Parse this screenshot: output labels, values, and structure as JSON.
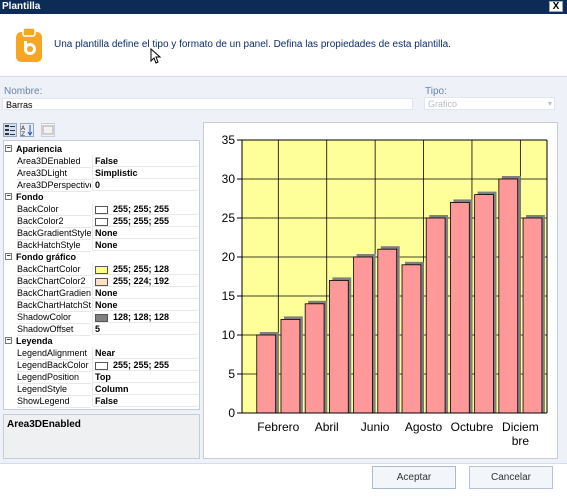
{
  "window": {
    "title": "Plantilla",
    "close_label": "X"
  },
  "header": {
    "intro": "Una plantilla define el tipo y formato de un panel. Defina las propiedades de esta plantilla.",
    "logo_icon": "template-document-icon"
  },
  "form": {
    "name_label": "Nombre:",
    "name_value": "Barras",
    "type_label": "Tipo:",
    "type_value": "Grafico"
  },
  "property_grid": {
    "categories": [
      {
        "name": "Apariencia",
        "items": [
          {
            "name": "Area3DEnabled",
            "value": "False"
          },
          {
            "name": "Area3DLight",
            "value": "Simplistic"
          },
          {
            "name": "Area3DPerspective",
            "value": "0"
          }
        ]
      },
      {
        "name": "Fondo",
        "items": [
          {
            "name": "BackColor",
            "value": "255; 255; 255",
            "swatch": "#ffffff"
          },
          {
            "name": "BackColor2",
            "value": "255; 255; 255",
            "swatch": "#ffffff"
          },
          {
            "name": "BackGradientStyle",
            "value": "None"
          },
          {
            "name": "BackHatchStyle",
            "value": "None"
          }
        ]
      },
      {
        "name": "Fondo gráfico",
        "items": [
          {
            "name": "BackChartColor",
            "value": "255; 255; 128",
            "swatch": "#ffff80"
          },
          {
            "name": "BackChartColor2",
            "value": "255; 224; 192",
            "swatch": "#ffe0c0"
          },
          {
            "name": "BackChartGradientS",
            "value": "None"
          },
          {
            "name": "BackChartHatchStyl",
            "value": "None"
          },
          {
            "name": "ShadowColor",
            "value": "128; 128; 128",
            "swatch": "#808080"
          },
          {
            "name": "ShadowOffset",
            "value": "5"
          }
        ]
      },
      {
        "name": "Leyenda",
        "items": [
          {
            "name": "LegendAlignment",
            "value": "Near"
          },
          {
            "name": "LegendBackColor",
            "value": "255; 255; 255",
            "swatch": "#ffffff"
          },
          {
            "name": "LegendPosition",
            "value": "Top"
          },
          {
            "name": "LegendStyle",
            "value": "Column"
          },
          {
            "name": "ShowLegend",
            "value": "False"
          }
        ]
      }
    ],
    "description_title": "Area3DEnabled"
  },
  "buttons": {
    "accept": "Aceptar",
    "cancel": "Cancelar"
  },
  "chart_data": {
    "type": "bar",
    "categories": [
      "",
      "Febrero",
      "",
      "Abril",
      "",
      "Junio",
      "",
      "Agosto",
      "",
      "Octubre",
      "",
      "Diciembre"
    ],
    "values": [
      10,
      12,
      14,
      17,
      20,
      21,
      19,
      25,
      27,
      28,
      30,
      25
    ],
    "ylim": [
      0,
      35
    ],
    "yticks": [
      0,
      5,
      10,
      15,
      20,
      25,
      30,
      35
    ],
    "x_tick_labels": [
      "Febrero",
      "Abril",
      "Junio",
      "Agosto",
      "Octubre",
      "Diciem",
      "bre"
    ],
    "grid": true,
    "legend": false,
    "bar_color": "#ff9999",
    "plot_background": "#ffff99",
    "shadow_color": "#808080"
  }
}
